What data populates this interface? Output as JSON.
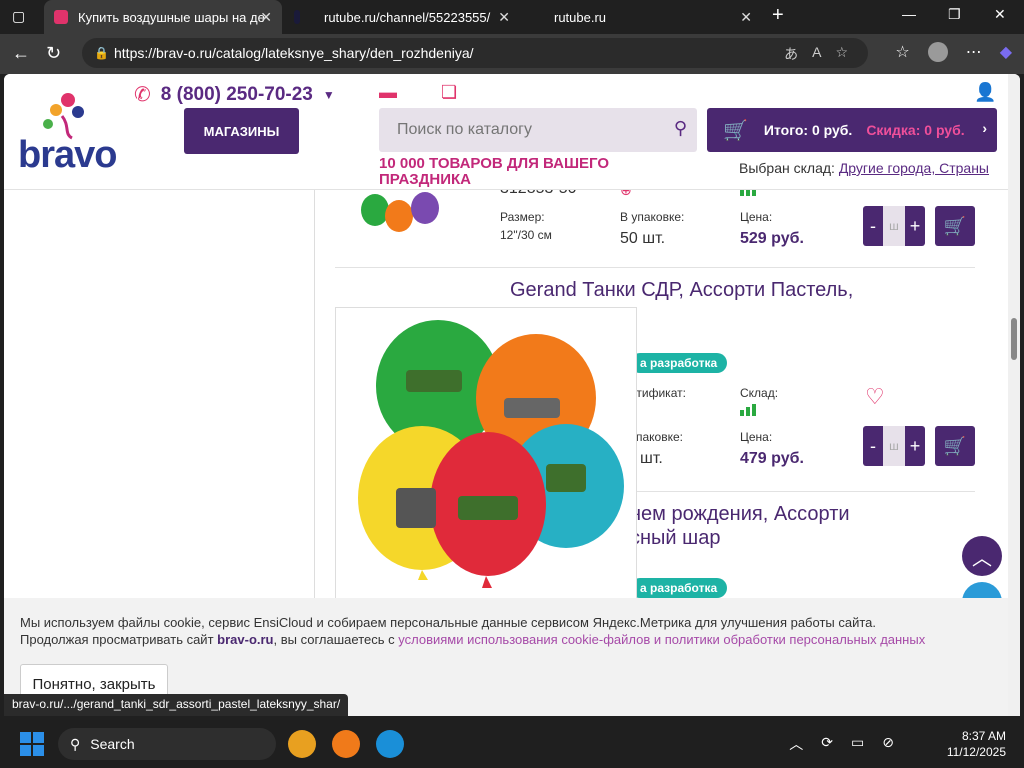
{
  "browser": {
    "tabs": [
      {
        "title": "Купить воздушные шары на де",
        "active": true
      },
      {
        "title": "rutube.ru/channel/55223555/",
        "active": false
      },
      {
        "title": "rutube.ru",
        "active": false
      }
    ],
    "url": "https://brav-o.ru/catalog/lateksnye_shary/den_rozhdeniya/",
    "status_url": "brav-o.ru/.../gerand_tanki_sdr_assorti_pastel_lateksnyy_shar/"
  },
  "header": {
    "logo_text": "bravo",
    "phone": "8 (800) 250-70-23",
    "stores_label": "МАГАЗИНЫ",
    "search_placeholder": "Поиск по каталогу",
    "promo": "10 000 ТОВАРОВ ДЛЯ ВАШЕГО ПРАЗДНИКА",
    "cart_total": "Итого: 0 руб.",
    "cart_discount": "Скидка: 0 руб.",
    "warehouse_label": "Выбран склад:",
    "warehouse_link": "Другие города, Страны"
  },
  "products": [
    {
      "sku": "312853-50",
      "size_label": "Размер:",
      "size_value": "12\"/30 см",
      "pack_label": "В упаковке:",
      "pack_value": "50 шт.",
      "price_label": "Цена:",
      "price_value": "529 руб."
    },
    {
      "name": "Gerand Танки СДР, Ассорти Пастель,",
      "badge": "а разработка",
      "cert_label": "отификат:",
      "stock_label": "Склад:",
      "pack_label": "упаковке:",
      "pack_value": "шт.",
      "price_label": "Цена:",
      "price_value": "479 руб."
    },
    {
      "name_line1": "нем рождения, Ассорти",
      "name_line2": "сный шар",
      "badge": "а разработка"
    }
  ],
  "qty_placeholder": "ш",
  "cookie": {
    "line1": "Мы используем файлы cookie, сервис EnsiCloud и собираем персональные данные сервисом Яндекс.Метрика для улучшения работы сайта.",
    "line2_start": "Продолжая просматривать сайт",
    "line2_mark": "brav-o.ru",
    "line2_mid": ", вы соглашаетесь с",
    "line2_link": "условиями использования cookie-файлов и политики обработки персональных данных",
    "button": "Понятно, закрыть"
  },
  "taskbar": {
    "search": "Search",
    "time": "8:37 AM",
    "date": "11/12/2025"
  },
  "colors": {
    "brand": "#4a2870",
    "accent": "#e0336b",
    "badge": "#1db3a5"
  }
}
